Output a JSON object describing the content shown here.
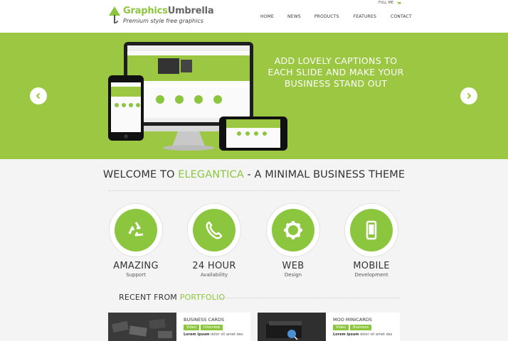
{
  "colors": {
    "accent": "#8cc63f",
    "hero_bg": "#9cc743",
    "text": "#333333"
  },
  "topbar": {
    "cart_label": "FULL ME",
    "cart_icon": "cart-icon"
  },
  "logo": {
    "name_part1": "Graphics",
    "name_part2": "Umbrella",
    "tagline": "Premium style free graphics",
    "icon": "tree-icon"
  },
  "nav": {
    "items": [
      "HOME",
      "NEWS",
      "PRODUCTS",
      "FEATURES",
      "CONTACT"
    ]
  },
  "hero": {
    "caption": "ADD LOVELY CAPTIONS TO EACH SLIDE AND MAKE YOUR BUSINESS STAND OUT",
    "prev_icon": "chevron-left-icon",
    "next_icon": "chevron-right-icon"
  },
  "welcome": {
    "prefix": "WELCOME TO ",
    "brand": "ELEGANTICA",
    "suffix": " - A MINIMAL BUSINESS THEME"
  },
  "features": [
    {
      "icon": "recycle-icon",
      "title": "AMAZING",
      "subtitle": "Support"
    },
    {
      "icon": "phone-icon",
      "title": "24 HOUR",
      "subtitle": "Availability"
    },
    {
      "icon": "gear-icon",
      "title": "WEB",
      "subtitle": "Design"
    },
    {
      "icon": "mobile-icon",
      "title": "MOBILE",
      "subtitle": "Development"
    }
  ],
  "portfolio": {
    "heading_prefix": "RECENT FROM ",
    "heading_accent": "PORTFOLIO",
    "items": [
      {
        "title": "BUSINESS CARDS",
        "tags": [
          "Video",
          "Interview"
        ],
        "excerpt_bold": "Lorem ipsum",
        "excerpt_rest": " dolor sit amet das"
      },
      {
        "title": "MOO MINICARDS",
        "tags": [
          "Video",
          "Business"
        ],
        "excerpt_bold": "Lorem ipsum",
        "excerpt_rest": " dolor sit amet das"
      }
    ]
  }
}
